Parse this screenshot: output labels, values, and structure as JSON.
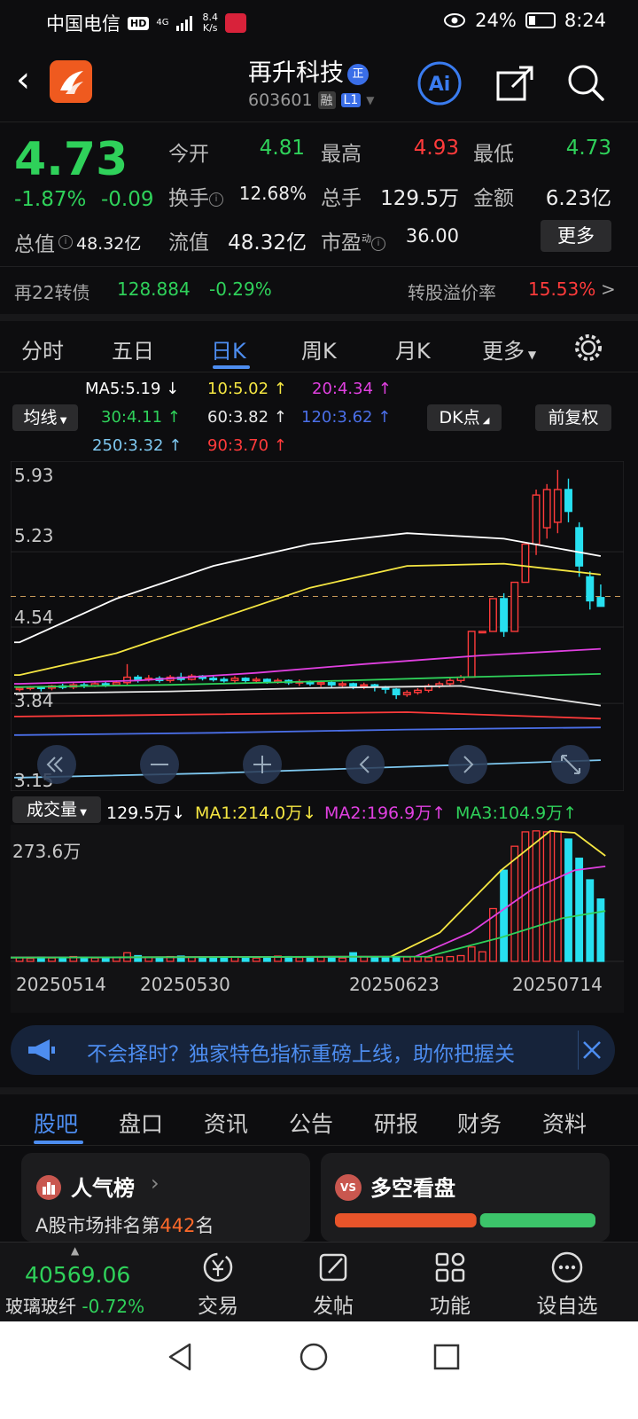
{
  "status": {
    "carrier": "中国电信",
    "hd": "HD",
    "network": "4G",
    "speed_value": "8.4",
    "speed_unit": "K/s",
    "battery": "24%",
    "time": "8:24"
  },
  "header": {
    "title": "再升科技",
    "title_badge": "正",
    "code": "603601",
    "tag_margin": "融",
    "tag_level": "L1",
    "ai_label": "Ai"
  },
  "quote": {
    "price": "4.73",
    "change_pct": "-1.87%",
    "change_abs": "-0.09",
    "open_label": "今开",
    "open": "4.81",
    "high_label": "最高",
    "high": "4.93",
    "low_label": "最低",
    "low": "4.73",
    "turnover_label": "换手",
    "turnover": "12.68%",
    "volume_label": "总手",
    "volume": "129.5万",
    "amount_label": "金额",
    "amount": "6.23亿",
    "mktcap_label": "总值",
    "mktcap": "48.32亿",
    "float_label": "流值",
    "float": "48.32亿",
    "pe_label": "市盈",
    "pe_sup": "动",
    "pe": "36.00",
    "more": "更多"
  },
  "bond": {
    "name": "再22转债",
    "price": "128.884",
    "change": "-0.29%",
    "premium_label": "转股溢价率",
    "premium": "15.53%",
    "arrow": ">"
  },
  "ktabs": [
    "分时",
    "五日",
    "日K",
    "周K",
    "月K",
    "更多"
  ],
  "legend": {
    "ma_button": "均线",
    "dk_button": "DK点",
    "adjust_button": "前复权",
    "items": [
      {
        "text": "MA5:5.19 ↓",
        "color": "#ffffff"
      },
      {
        "text": "10:5.02 ↑",
        "color": "#f5e642"
      },
      {
        "text": "20:4.34 ↑",
        "color": "#e040e0"
      },
      {
        "text": "30:4.11 ↑",
        "color": "#2fd15a"
      },
      {
        "text": "60:3.82 ↑",
        "color": "#e6e6e6"
      },
      {
        "text": "120:3.62 ↑",
        "color": "#4b6fe8"
      },
      {
        "text": "250:3.32 ↑",
        "color": "#7ec8f0"
      },
      {
        "text": "90:3.70 ↑",
        "color": "#ff3b3b"
      }
    ]
  },
  "chart_data": {
    "type": "candlestick",
    "y_axis_labels": [
      "5.93",
      "5.23",
      "4.54",
      "3.84",
      "3.15"
    ],
    "ylim": [
      3.15,
      5.93
    ],
    "dates": [
      "20250514",
      "20250530",
      "20250623",
      "20250714"
    ],
    "candles": [
      [
        3.97,
        3.98,
        3.95,
        3.99
      ],
      [
        3.98,
        3.99,
        3.96,
        4.0
      ],
      [
        3.99,
        3.98,
        3.95,
        4.0
      ],
      [
        3.98,
        4.0,
        3.96,
        4.01
      ],
      [
        4.0,
        3.99,
        3.97,
        4.02
      ],
      [
        3.99,
        4.01,
        3.97,
        4.03
      ],
      [
        4.01,
        4.0,
        3.98,
        4.03
      ],
      [
        4.0,
        4.02,
        3.99,
        4.04
      ],
      [
        4.02,
        4.01,
        3.99,
        4.04
      ],
      [
        4.01,
        4.03,
        4.0,
        4.05
      ],
      [
        4.03,
        4.08,
        4.0,
        4.2
      ],
      [
        4.08,
        4.06,
        4.03,
        4.1
      ],
      [
        4.06,
        4.07,
        4.04,
        4.1
      ],
      [
        4.07,
        4.05,
        4.03,
        4.09
      ],
      [
        4.05,
        4.08,
        4.03,
        4.1
      ],
      [
        4.08,
        4.06,
        4.04,
        4.12
      ],
      [
        4.06,
        4.09,
        4.05,
        4.11
      ],
      [
        4.09,
        4.07,
        4.05,
        4.1
      ],
      [
        4.07,
        4.06,
        4.04,
        4.09
      ],
      [
        4.06,
        4.05,
        4.03,
        4.08
      ],
      [
        4.05,
        4.07,
        4.03,
        4.09
      ],
      [
        4.07,
        4.05,
        4.03,
        4.08
      ],
      [
        4.05,
        4.06,
        4.03,
        4.08
      ],
      [
        4.06,
        4.04,
        4.02,
        4.07
      ],
      [
        4.04,
        4.05,
        4.02,
        4.07
      ],
      [
        4.05,
        4.03,
        4.01,
        4.06
      ],
      [
        4.03,
        4.04,
        4.0,
        4.06
      ],
      [
        4.04,
        4.02,
        4.0,
        4.05
      ],
      [
        4.02,
        4.03,
        3.99,
        4.05
      ],
      [
        4.03,
        4.01,
        3.98,
        4.04
      ],
      [
        4.01,
        4.02,
        3.98,
        4.04
      ],
      [
        4.02,
        4.0,
        3.97,
        4.03
      ],
      [
        4.0,
        4.01,
        3.97,
        4.03
      ],
      [
        4.01,
        3.99,
        3.95,
        4.02
      ],
      [
        3.99,
        3.97,
        3.93,
        4.0
      ],
      [
        3.97,
        3.92,
        3.88,
        3.98
      ],
      [
        3.92,
        3.94,
        3.9,
        3.96
      ],
      [
        3.94,
        3.96,
        3.92,
        3.98
      ],
      [
        3.96,
        4.0,
        3.94,
        4.02
      ],
      [
        4.0,
        4.02,
        3.98,
        4.04
      ],
      [
        4.02,
        4.05,
        4.0,
        4.07
      ],
      [
        4.05,
        4.08,
        4.03,
        4.1
      ],
      [
        4.08,
        4.5,
        4.08,
        4.5
      ],
      [
        4.5,
        4.5,
        4.5,
        4.5
      ],
      [
        4.5,
        4.8,
        4.5,
        4.8
      ],
      [
        4.8,
        4.5,
        4.45,
        4.85
      ],
      [
        4.5,
        4.95,
        4.5,
        4.95
      ],
      [
        4.95,
        5.3,
        4.95,
        5.3
      ],
      [
        5.3,
        5.75,
        5.2,
        5.8
      ],
      [
        5.45,
        5.8,
        5.35,
        5.85
      ],
      [
        5.5,
        5.8,
        5.4,
        5.98
      ],
      [
        5.8,
        5.6,
        5.5,
        5.9
      ],
      [
        5.45,
        5.1,
        5.0,
        5.5
      ],
      [
        5.0,
        4.78,
        4.7,
        5.05
      ],
      [
        4.81,
        4.73,
        4.73,
        4.93
      ]
    ],
    "ma_series": [
      {
        "name": "MA5",
        "color": "#ffffff",
        "values": [
          4.4,
          4.8,
          5.1,
          5.3,
          5.4,
          5.35,
          5.19
        ]
      },
      {
        "name": "10",
        "color": "#f5e642",
        "values": [
          4.1,
          4.3,
          4.6,
          4.9,
          5.1,
          5.12,
          5.02
        ]
      },
      {
        "name": "20",
        "color": "#e040e0",
        "values": [
          4.02,
          4.05,
          4.12,
          4.2,
          4.28,
          4.34
        ]
      },
      {
        "name": "30",
        "color": "#2fd15a",
        "values": [
          3.99,
          4.01,
          4.04,
          4.08,
          4.11
        ]
      },
      {
        "name": "60",
        "color": "#e6e6e6",
        "values": [
          3.93,
          3.95,
          3.98,
          4.0,
          3.82
        ]
      },
      {
        "name": "120",
        "color": "#4b6fe8",
        "values": [
          3.55,
          3.57,
          3.6,
          3.62
        ]
      },
      {
        "name": "250",
        "color": "#7ec8f0",
        "values": [
          3.16,
          3.2,
          3.26,
          3.32
        ]
      },
      {
        "name": "90",
        "color": "#ff3b3b",
        "values": [
          3.72,
          3.74,
          3.76,
          3.7
        ]
      }
    ],
    "reference_price": 4.82
  },
  "volume": {
    "label": "成交量",
    "current": "129.5万↓",
    "ma1": "MA1:214.0万↓",
    "ma2": "MA2:196.9万↑",
    "ma3": "MA3:104.9万↑",
    "axis_max": "273.6万",
    "ylim_max": 273.6,
    "values": [
      8,
      6,
      9,
      7,
      8,
      10,
      6,
      7,
      8,
      9,
      18,
      12,
      9,
      8,
      10,
      11,
      9,
      8,
      7,
      9,
      10,
      8,
      7,
      9,
      11,
      10,
      8,
      7,
      9,
      8,
      7,
      18,
      10,
      9,
      7,
      8,
      9,
      10,
      8,
      9,
      10,
      12,
      30,
      20,
      110,
      190,
      240,
      270,
      272,
      270,
      270,
      255,
      215,
      170,
      130
    ]
  },
  "ad": {
    "text": "不会择时？独家特色指标重磅上线，助你把握关"
  },
  "btabs": [
    "股吧",
    "盘口",
    "资讯",
    "公告",
    "研报",
    "财务",
    "资料"
  ],
  "cards": {
    "popular_title": "人气榜",
    "popular_arrow": "›",
    "popular_rank_prefix": "A股市场排名第",
    "popular_rank": "442",
    "popular_rank_suffix": "名",
    "vs_badge": "VS",
    "vs_title": "多空看盘",
    "bull_share": 0.55
  },
  "bottomnav": {
    "index_value": "40569.06",
    "index_name": "玻璃玻纤",
    "index_change": "-0.72%",
    "trade": "交易",
    "post": "发帖",
    "features": "功能",
    "watchlist": "设自选"
  },
  "colors": {
    "up": "#ff3b3b",
    "down": "#2fd15a",
    "candle_down": "#27e0f0",
    "accent": "#4d8df0"
  }
}
